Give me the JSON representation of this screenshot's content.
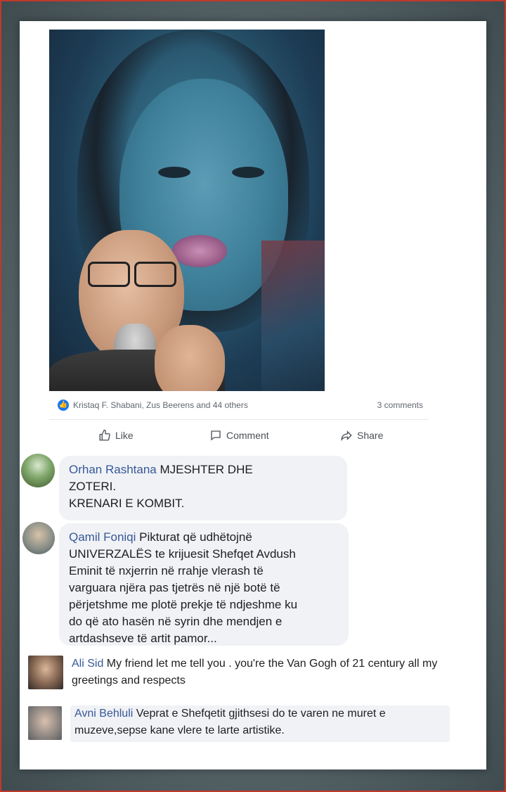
{
  "post": {
    "reactions_text": "Kristaq F. Shabani, Zus Beerens and 44 others",
    "comments_count": "3 comments",
    "like_label": "Like",
    "comment_label": "Comment",
    "share_label": "Share"
  },
  "comments": [
    {
      "author": "Orhan Rashtana",
      "text": " MJESHTER DHE",
      "lines": [
        "ZOTERI.",
        "KRENARI E KOMBIT."
      ]
    },
    {
      "author": "Qamil Foniqi",
      "text": " Pikturat që udhëtojnë",
      "lines": [
        "UNIVERZALËS te krijuesit Shefqet Avdush",
        "Eminit të nxjerrin në rrahje vlerash të",
        "varguara njëra pas tjetrës në një botë të",
        "përjetshme me plotë prekje të ndjeshme ku",
        "do që ato hasën në syrin dhe mendjen e",
        "artdashseve të artit pamor..."
      ]
    },
    {
      "author": "Ali Sid",
      "text": " My friend let me tell you . you're the Van Gogh of 21 century all my",
      "lines": [
        "greetings and respects"
      ]
    },
    {
      "author": "Avni Behluli",
      "text": " Veprat e Shefqetit gjithsesi do te varen ne muret e",
      "lines": [
        "muzeve,sepse kane vlere te larte artistike."
      ]
    }
  ],
  "colors": {
    "link": "#385898",
    "like": "#1877f2",
    "bubble": "#f0f2f5"
  }
}
